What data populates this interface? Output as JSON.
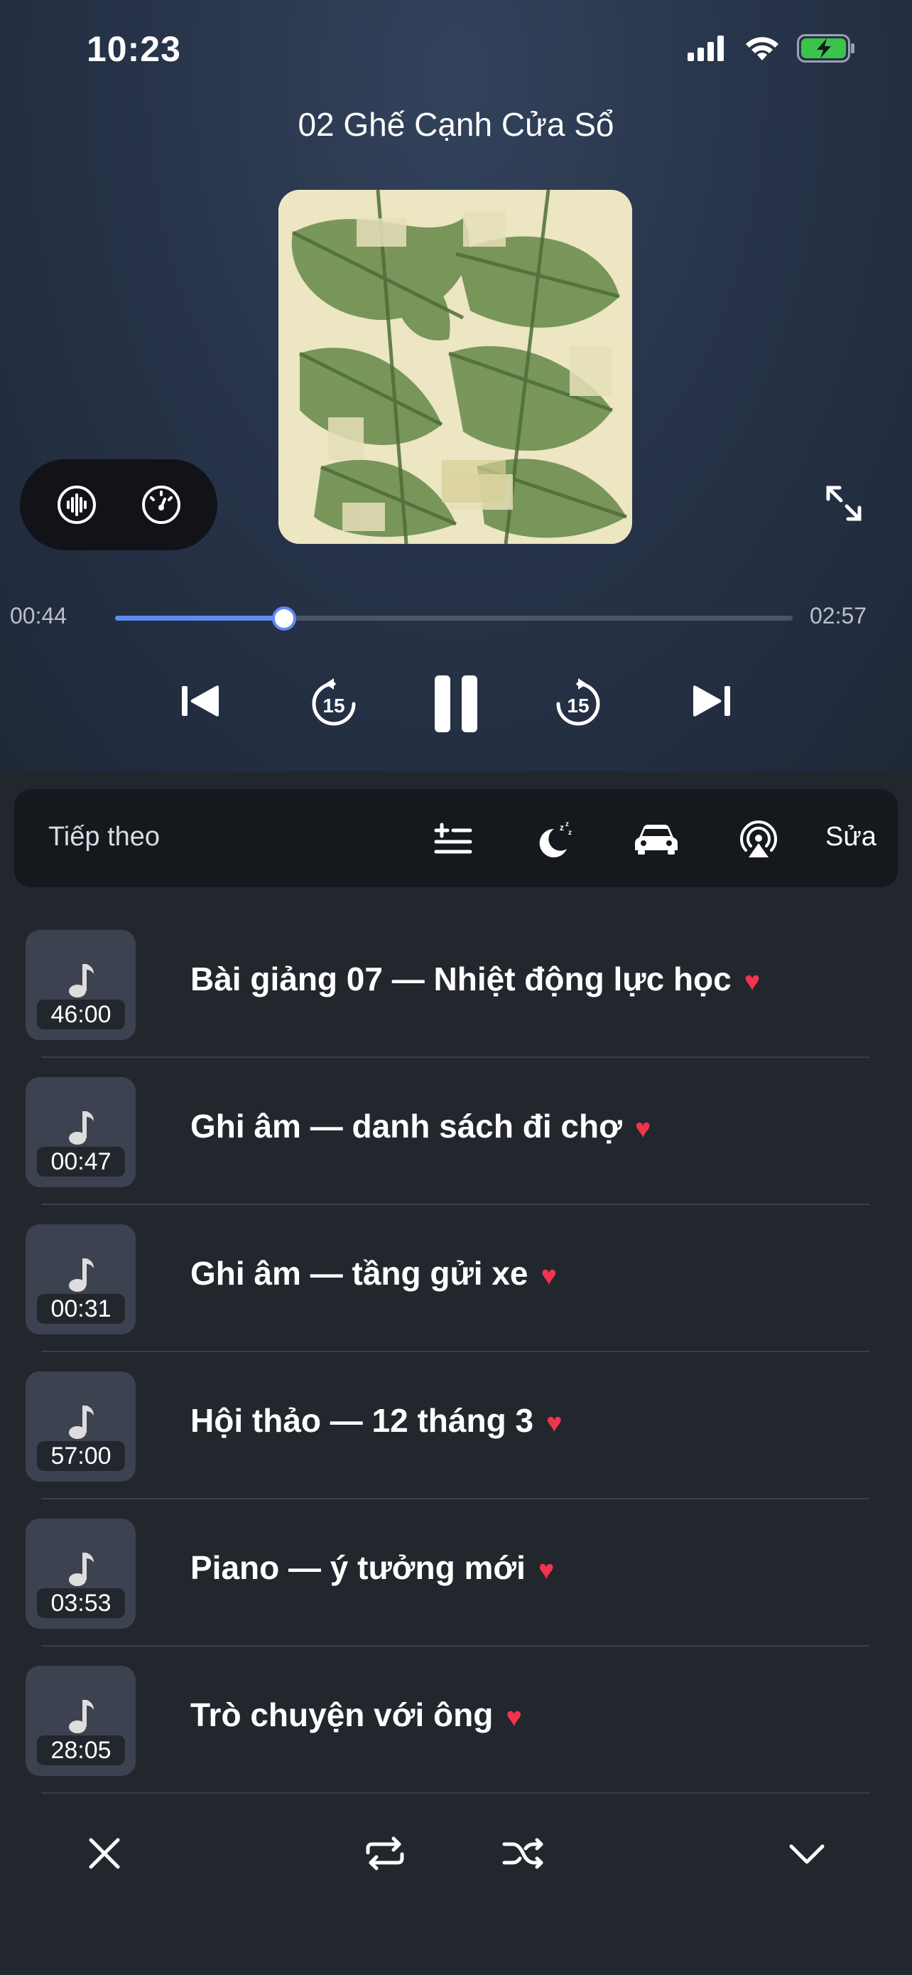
{
  "status": {
    "time": "10:23"
  },
  "now_playing": {
    "title": "02 Ghế Cạnh Cửa Sổ",
    "elapsed": "00:44",
    "duration": "02:57",
    "progress": 0.2486
  },
  "toolbar": {
    "up_next_label": "Tiếp theo",
    "edit_label": "Sửa"
  },
  "queue": [
    {
      "title": "Bài giảng 07 — Nhiệt động lực học",
      "duration": "46:00",
      "favorite": true
    },
    {
      "title": "Ghi âm — danh sách đi chợ",
      "duration": "00:47",
      "favorite": true
    },
    {
      "title": "Ghi âm — tầng gửi xe",
      "duration": "00:31",
      "favorite": true
    },
    {
      "title": "Hội thảo — 12 tháng 3",
      "duration": "57:00",
      "favorite": true
    },
    {
      "title": "Piano — ý tưởng mới",
      "duration": "03:53",
      "favorite": true
    },
    {
      "title": "Trò chuyện với ông",
      "duration": "28:05",
      "favorite": true
    }
  ],
  "colors": {
    "accent": "#5d8bf0",
    "heart": "#f2344f",
    "battery": "#3bc44b"
  }
}
